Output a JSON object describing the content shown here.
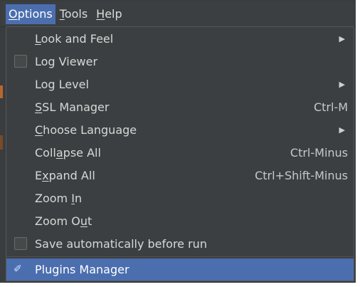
{
  "menubar": {
    "items": [
      {
        "label": "Options",
        "mnemonic_index": 0
      },
      {
        "label": "Tools",
        "mnemonic_index": 0
      },
      {
        "label": "Help",
        "mnemonic_index": 0
      }
    ]
  },
  "menu": {
    "items": [
      {
        "label": "Look and Feel",
        "shortcut": "",
        "submenu": true,
        "checkbox": false
      },
      {
        "label": "Log Viewer",
        "shortcut": "",
        "submenu": false,
        "checkbox": true,
        "checked": false
      },
      {
        "label": "Log Level",
        "shortcut": "",
        "submenu": true,
        "checkbox": false
      },
      {
        "label": "SSL Manager",
        "shortcut": "Ctrl-M",
        "submenu": false,
        "checkbox": false
      },
      {
        "label": "Choose Language",
        "shortcut": "",
        "submenu": true,
        "checkbox": false
      },
      {
        "label": "Collapse All",
        "shortcut": "Ctrl-Minus",
        "submenu": false,
        "checkbox": false
      },
      {
        "label": "Expand All",
        "shortcut": "Ctrl+Shift-Minus",
        "submenu": false,
        "checkbox": false
      },
      {
        "label": "Zoom In",
        "shortcut": "",
        "submenu": false,
        "checkbox": false
      },
      {
        "label": "Zoom Out",
        "shortcut": "",
        "submenu": false,
        "checkbox": false
      },
      {
        "label": "Save automatically before run",
        "shortcut": "",
        "submenu": false,
        "checkbox": true,
        "checked": false
      },
      {
        "label": "Plugins Manager",
        "shortcut": "",
        "submenu": false,
        "checkbox": false,
        "selected": true
      }
    ]
  },
  "icons": {
    "submenu_arrow": "triangle-right-icon",
    "plugins": "plugin-icon"
  },
  "colors": {
    "menu_bg": "#3c3f41",
    "highlight": "#4b6eaf",
    "text": "#d7d7d7"
  }
}
